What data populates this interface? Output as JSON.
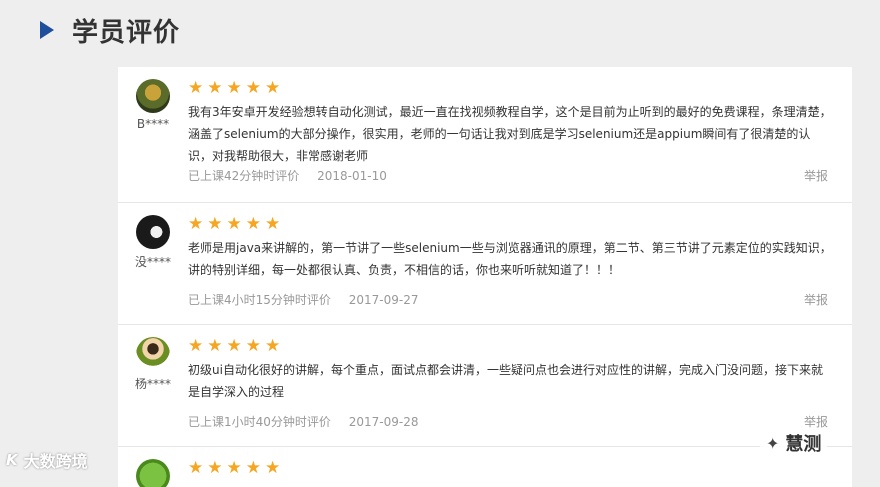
{
  "section": {
    "title": "学员评价"
  },
  "reviews": [
    {
      "username": "B****",
      "stars": 5,
      "text": "我有3年安卓开发经验想转自动化测试，最近一直在找视频教程自学，这个是目前为止听到的最好的免费课程，条理清楚，涵盖了selenium的大部分操作，很实用，老师的一句话让我对到底是学习selenium还是appium瞬间有了很清楚的认识，对我帮助很大，非常感谢老师",
      "study_time": "已上课42分钟时评价",
      "date": "2018-01-10",
      "report_label": "举报"
    },
    {
      "username": "没****",
      "stars": 5,
      "text": "老师是用java来讲解的，第一节讲了一些selenium一些与浏览器通讯的原理，第二节、第三节讲了元素定位的实践知识，讲的特别详细，每一处都很认真、负责，不相信的话，你也来听听就知道了！！！",
      "study_time": "已上课4小时15分钟时评价",
      "date": "2017-09-27",
      "report_label": "举报"
    },
    {
      "username": "杨****",
      "stars": 5,
      "text": "初级ui自动化很好的讲解，每个重点，面试点都会讲清，一些疑问点也会进行对应性的讲解，完成入门没问题，接下来就是自学深入的过程",
      "study_time": "已上课1小时40分钟时评价",
      "date": "2017-09-28",
      "report_label": "举报"
    },
    {
      "username": "",
      "stars": 5,
      "text": "",
      "study_time": "",
      "date": "",
      "report_label": ""
    }
  ],
  "watermarks": {
    "left": "大数跨境",
    "left_logo": "K",
    "right": "慧测"
  },
  "colors": {
    "accent": "#1d4f9c",
    "star": "#f5a623"
  }
}
